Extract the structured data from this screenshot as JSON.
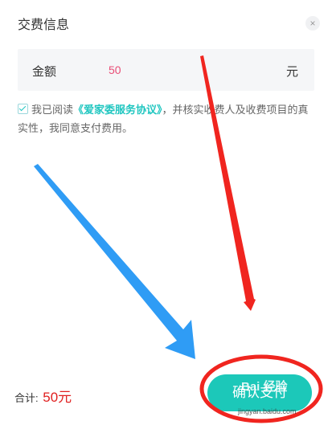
{
  "dialog": {
    "title": "交费信息",
    "close_icon": "×"
  },
  "amount": {
    "label": "金额",
    "value": "50",
    "unit": "元"
  },
  "agreement": {
    "prefix": "我已阅读",
    "link": "《爱家委服务协议》",
    "suffix": "，并核实收费人及收费项目的真实性，我同意支付费用。"
  },
  "footer": {
    "total_label": "合计:",
    "total_amount": "50元",
    "pay_button": "确认支付"
  },
  "watermark": {
    "brand": "Bai 经验",
    "url": "jingyan.baidu.com"
  },
  "colors": {
    "accent": "#1cc8b9",
    "amount": "#e94e77",
    "total": "#e02020",
    "annotation_red": "#f0251f",
    "annotation_blue": "#2f9cf5"
  }
}
